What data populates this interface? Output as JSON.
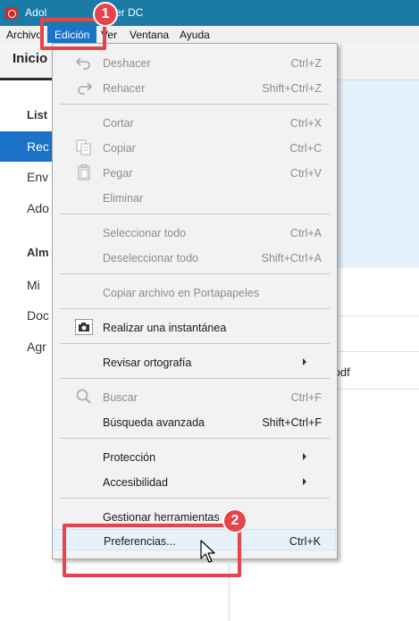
{
  "window": {
    "title": "Adobe Acrobat Reader DC",
    "title_visible_start": "Adol",
    "title_visible_end": "er DC"
  },
  "menubar": {
    "items": [
      {
        "label": "Archivo"
      },
      {
        "label": "Edición",
        "active": true
      },
      {
        "label": "Ver"
      },
      {
        "label": "Ventana"
      },
      {
        "label": "Ayuda"
      }
    ]
  },
  "background": {
    "home_tab": "Inicio",
    "left_items": [
      {
        "label": "List",
        "header": true
      },
      {
        "label": "Rec",
        "selected": true
      },
      {
        "label": "Env"
      },
      {
        "label": "Ado"
      },
      {
        "label": "Alm",
        "header": true
      },
      {
        "label": "Mi "
      },
      {
        "label": "Doc"
      },
      {
        "label": "Agr"
      }
    ],
    "file_snippet": ".pdf"
  },
  "edit_menu": {
    "items": [
      {
        "label": "Deshacer",
        "shortcut": "Ctrl+Z",
        "disabled": true,
        "icon": "undo-icon"
      },
      {
        "label": "Rehacer",
        "shortcut": "Shift+Ctrl+Z",
        "disabled": true,
        "icon": "redo-icon"
      },
      {
        "label": "Cortar",
        "shortcut": "Ctrl+X",
        "disabled": true
      },
      {
        "label": "Copiar",
        "shortcut": "Ctrl+C",
        "disabled": true,
        "icon": "copy-icon"
      },
      {
        "label": "Pegar",
        "shortcut": "Ctrl+V",
        "disabled": true,
        "icon": "paste-icon"
      },
      {
        "label": "Eliminar",
        "shortcut": "",
        "disabled": true
      },
      {
        "label": "Seleccionar todo",
        "shortcut": "Ctrl+A",
        "disabled": true
      },
      {
        "label": "Deseleccionar todo",
        "shortcut": "Shift+Ctrl+A",
        "disabled": true
      },
      {
        "label": "Copiar archivo en Portapapeles",
        "shortcut": "",
        "disabled": true
      },
      {
        "label": "Realizar una instantánea",
        "shortcut": "",
        "disabled": false,
        "icon": "camera-icon"
      },
      {
        "label": "Revisar ortografía",
        "shortcut": "",
        "disabled": false,
        "submenu": true
      },
      {
        "label": "Buscar",
        "shortcut": "Ctrl+F",
        "disabled": true,
        "icon": "search-icon"
      },
      {
        "label": "Búsqueda avanzada",
        "shortcut": "Shift+Ctrl+F",
        "disabled": false
      },
      {
        "label": "Protección",
        "shortcut": "",
        "disabled": false,
        "submenu": true
      },
      {
        "label": "Accesibilidad",
        "shortcut": "",
        "disabled": false,
        "submenu": true
      },
      {
        "label": "Gestionar herramientas",
        "shortcut": "",
        "disabled": false
      },
      {
        "label": "Preferencias...",
        "shortcut": "Ctrl+K",
        "disabled": false,
        "hover": true
      }
    ]
  },
  "callouts": {
    "step1": "1",
    "step2": "2"
  },
  "colors": {
    "titlebar": "#1a7ba5",
    "selection": "#1a73c8",
    "callout": "#e5454a",
    "hover": "#e5f1fb"
  }
}
